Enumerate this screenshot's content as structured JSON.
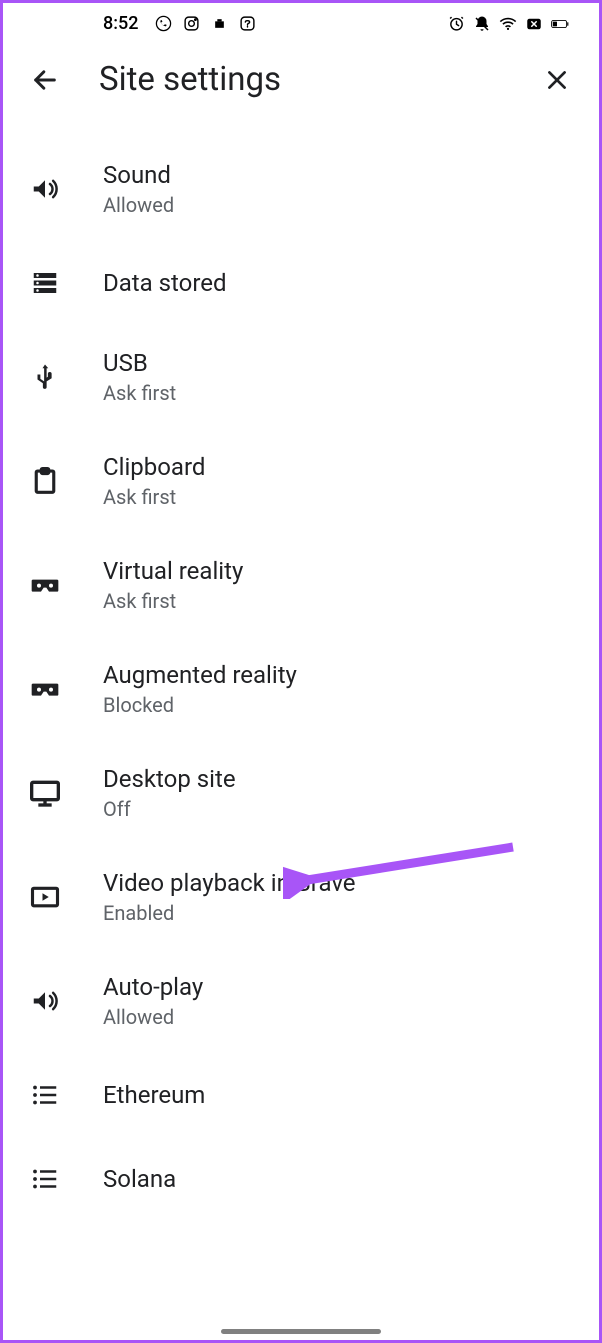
{
  "status": {
    "time": "8:52"
  },
  "header": {
    "title": "Site settings"
  },
  "settings": [
    {
      "icon": "sound",
      "title": "Sound",
      "subtitle": "Allowed"
    },
    {
      "icon": "storage",
      "title": "Data stored",
      "subtitle": null
    },
    {
      "icon": "usb",
      "title": "USB",
      "subtitle": "Ask first"
    },
    {
      "icon": "clipboard",
      "title": "Clipboard",
      "subtitle": "Ask first"
    },
    {
      "icon": "vr",
      "title": "Virtual reality",
      "subtitle": "Ask first"
    },
    {
      "icon": "ar",
      "title": "Augmented reality",
      "subtitle": "Blocked"
    },
    {
      "icon": "desktop",
      "title": "Desktop site",
      "subtitle": "Off"
    },
    {
      "icon": "video",
      "title": "Video playback in Brave",
      "subtitle": "Enabled"
    },
    {
      "icon": "autoplay",
      "title": "Auto-play",
      "subtitle": "Allowed"
    },
    {
      "icon": "list",
      "title": "Ethereum",
      "subtitle": null
    },
    {
      "icon": "list",
      "title": "Solana",
      "subtitle": null
    }
  ]
}
